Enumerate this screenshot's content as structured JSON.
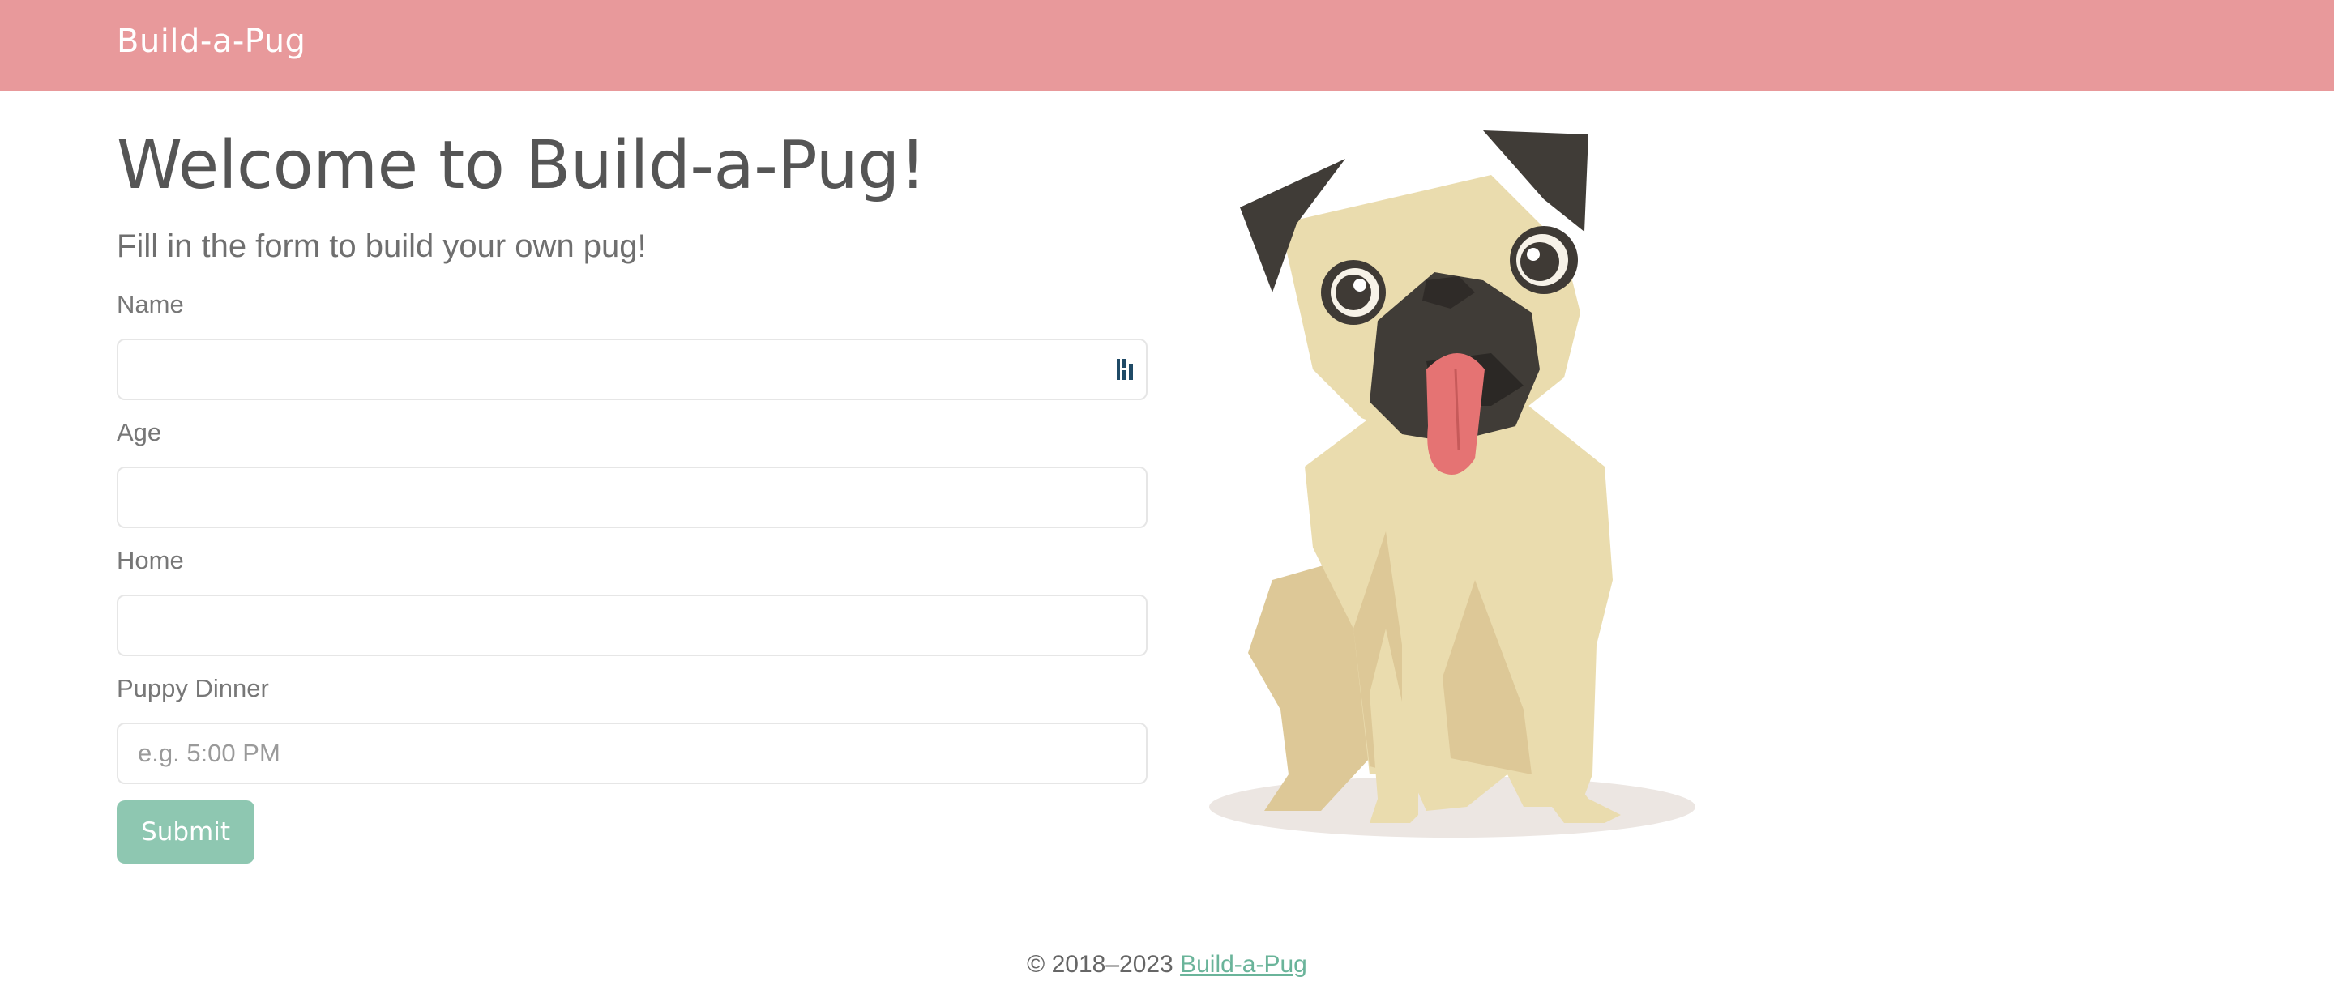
{
  "navbar": {
    "brand": "Build-a-Pug"
  },
  "main": {
    "title": "Welcome to Build-a-Pug!",
    "lead": "Fill in the form to build your own pug!"
  },
  "form": {
    "fields": [
      {
        "label": "Name",
        "value": "",
        "placeholder": ""
      },
      {
        "label": "Age",
        "value": "",
        "placeholder": ""
      },
      {
        "label": "Home",
        "value": "",
        "placeholder": ""
      },
      {
        "label": "Puppy Dinner",
        "value": "",
        "placeholder": "e.g. 5:00 PM"
      }
    ],
    "submit_label": "Submit"
  },
  "footer": {
    "copyright": "© 2018–2023 ",
    "link_text": "Build-a-Pug"
  },
  "colors": {
    "navbar": "#e8999b",
    "submit": "#8ec7b1",
    "link": "#6ab49a"
  },
  "icons": {
    "name_field_icon": "password-manager-icon",
    "illustration": "pug-illustration"
  }
}
